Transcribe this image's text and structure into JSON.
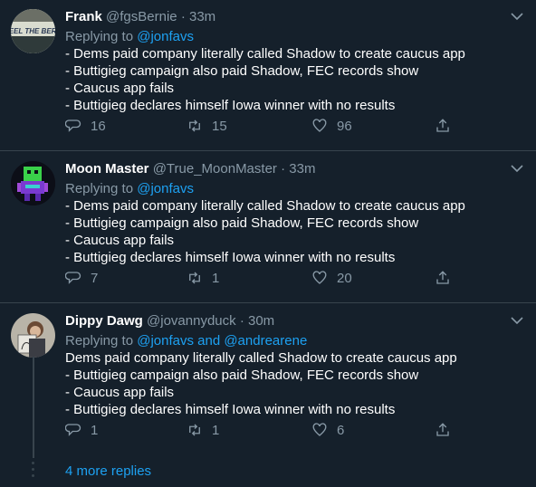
{
  "tweets": [
    {
      "name": "Frank",
      "handle": "@fgsBernie",
      "dot": "·",
      "time": "33m",
      "replying_prefix": "Replying to ",
      "replying_to": "@jonfavs",
      "body": "- Dems paid company literally called Shadow to create caucus app\n- Buttigieg campaign also paid Shadow, FEC records show\n- Caucus app fails\n- Buttigieg declares himself Iowa winner with no results",
      "avatar_text": "FEEL THE BERN",
      "replies": "16",
      "retweets": "15",
      "likes": "96"
    },
    {
      "name": "Moon Master",
      "handle": "@True_MoonMaster",
      "dot": "·",
      "time": "33m",
      "replying_prefix": "Replying to ",
      "replying_to": "@jonfavs",
      "body": "- Dems paid company literally called Shadow to create caucus app\n- Buttigieg campaign also paid Shadow, FEC records show\n- Caucus app fails\n- Buttigieg declares himself Iowa winner with no results",
      "replies": "7",
      "retweets": "1",
      "likes": "20"
    },
    {
      "name": "Dippy Dawg",
      "handle": "@jovannyduck",
      "dot": "·",
      "time": "30m",
      "replying_prefix": "Replying to ",
      "replying_to": "@jonfavs and @andrearene",
      "body": "Dems paid company literally called Shadow to create caucus app\n- Buttigieg campaign also paid Shadow, FEC records show\n- Caucus app fails\n- Buttigieg declares himself Iowa winner with no results",
      "replies": "1",
      "retweets": "1",
      "likes": "6"
    }
  ],
  "more_replies": "4 more replies",
  "colors": {
    "background": "#15202b",
    "text": "#ffffff",
    "muted": "#8899a6",
    "link": "#1da1f2",
    "divider": "#38444d"
  }
}
